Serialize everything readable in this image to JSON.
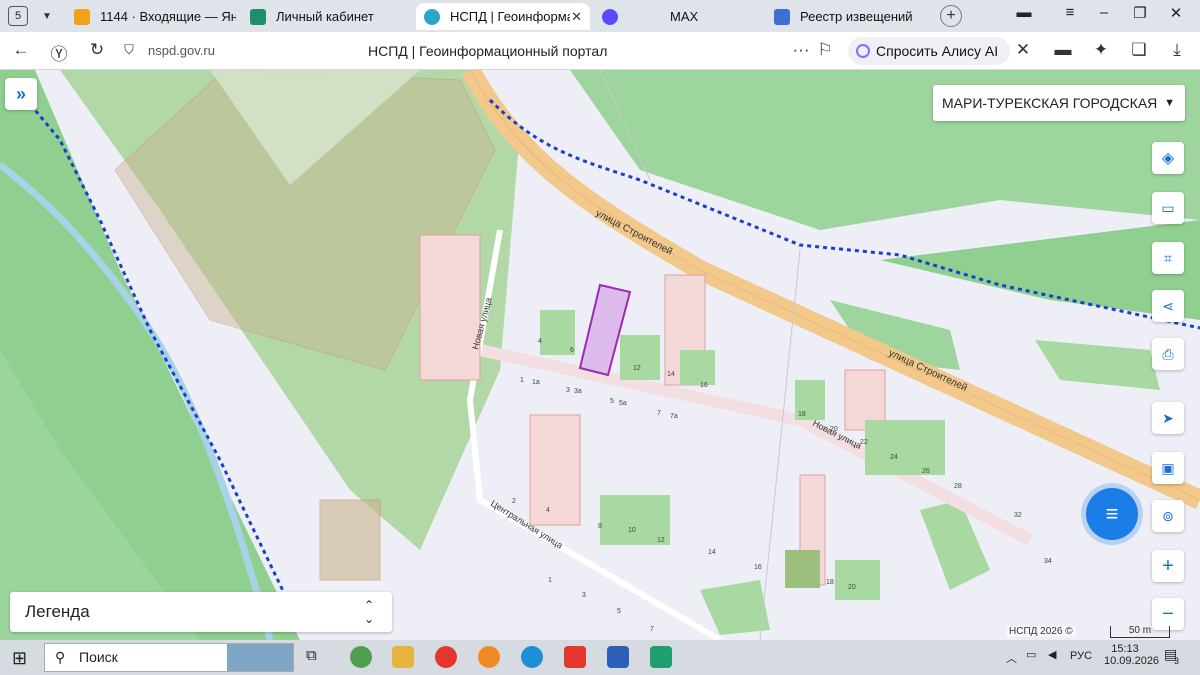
{
  "browser": {
    "tab_count": "5",
    "tabs": [
      {
        "title": "1144 · Входящие — Яндекс"
      },
      {
        "title": "Личный кабинет"
      },
      {
        "title": "НСПД | Геоинформационный портал"
      },
      {
        "title": "MAX"
      },
      {
        "title": "Реестр извещений"
      }
    ],
    "url": "nspd.gov.ru",
    "page_title": "НСПД | Геоинформационный портал",
    "alice_label": "Спросить Алису AI"
  },
  "map": {
    "region_select": "МАРИ-ТУРЕКСКАЯ ГОРОДСКАЯ",
    "legend_label": "Легенда",
    "copyright": "НСПД 2026 ©",
    "scale_label": "50 m",
    "streets": {
      "stroiteley_1": "улица Строителей",
      "stroiteley_2": "улица Строителей",
      "novaya_1": "Новая улица",
      "novaya_2": "Новая улица",
      "centralnaya": "Центральная улица"
    },
    "house_numbers": [
      "4",
      "6",
      "12",
      "14",
      "16",
      "1",
      "1а",
      "3",
      "3а",
      "5",
      "5а",
      "7",
      "7а",
      "18",
      "20",
      "22",
      "24",
      "26",
      "28",
      "2",
      "4",
      "8",
      "10",
      "12",
      "14",
      "16",
      "18",
      "20",
      "32",
      "34",
      "1",
      "3",
      "5",
      "7"
    ],
    "colors": {
      "forest": "#8fcf8f",
      "road": "#f2c98a",
      "highlight": "#9b2bb0",
      "boundary": "#1a3fd0"
    }
  },
  "taskbar": {
    "search_label": "Поиск",
    "lang": "РУС",
    "time": "15:13",
    "date": "10.09.2026",
    "notif_count": "3"
  }
}
